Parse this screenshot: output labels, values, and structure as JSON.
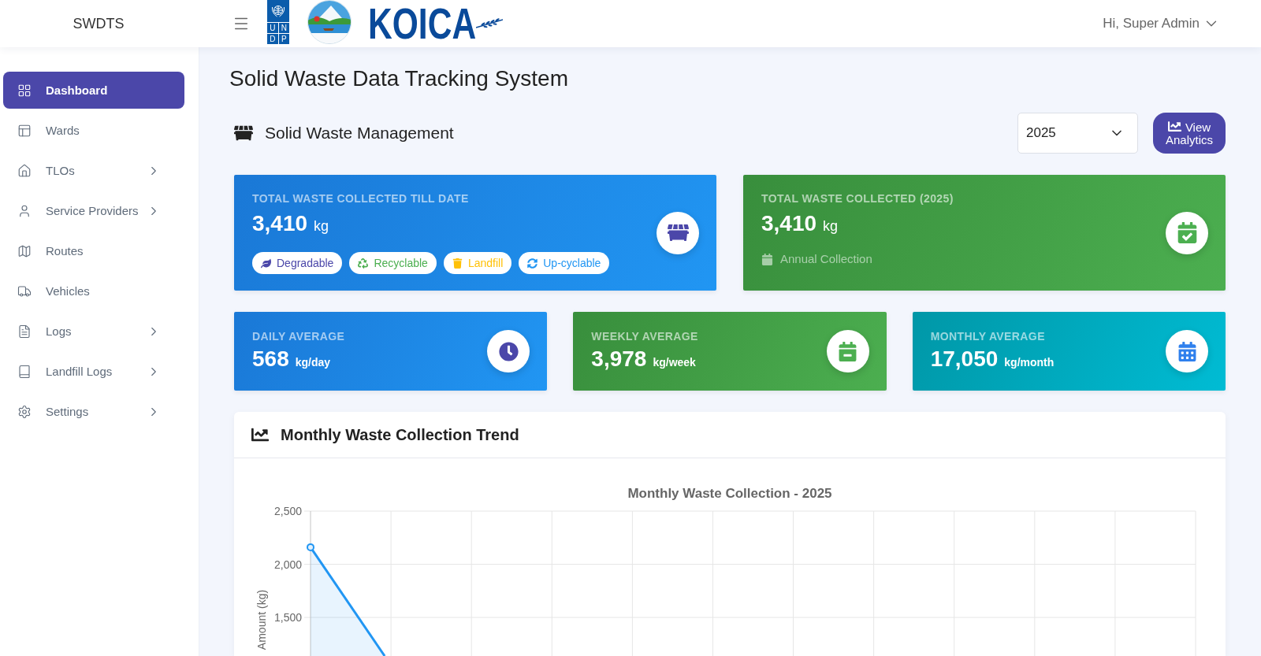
{
  "header": {
    "brand": "SWDTS",
    "undp_logo_letters": [
      "U",
      "N",
      "D",
      "P"
    ],
    "partner_logo_text": "KOICA",
    "user_greeting": "Hi, Super Admin"
  },
  "sidebar": {
    "items": [
      {
        "label": "Dashboard",
        "selected": true,
        "expandable": false
      },
      {
        "label": "Wards",
        "selected": false,
        "expandable": false
      },
      {
        "label": "TLOs",
        "selected": false,
        "expandable": true
      },
      {
        "label": "Service Providers",
        "selected": false,
        "expandable": true
      },
      {
        "label": "Routes",
        "selected": false,
        "expandable": false
      },
      {
        "label": "Vehicles",
        "selected": false,
        "expandable": false
      },
      {
        "label": "Logs",
        "selected": false,
        "expandable": true
      },
      {
        "label": "Landfill Logs",
        "selected": false,
        "expandable": true
      },
      {
        "label": "Settings",
        "selected": false,
        "expandable": true
      }
    ]
  },
  "page": {
    "title": "Solid Waste Data Tracking System"
  },
  "section": {
    "title": "Solid Waste Management",
    "year_select": "2025",
    "analytics_button": "View Analytics"
  },
  "summary_cards": [
    {
      "label": "TOTAL WASTE COLLECTED TILL DATE",
      "value": "3,410",
      "unit": "kg",
      "tags": [
        {
          "label": "Degradable",
          "color": "#4b47a9"
        },
        {
          "label": "Recyclable",
          "color": "#4caf50"
        },
        {
          "label": "Landfill",
          "color": "#ffc107"
        },
        {
          "label": "Up-cyclable",
          "color": "#2196f3"
        }
      ]
    },
    {
      "label": "TOTAL WASTE COLLECTED (2025)",
      "value": "3,410",
      "unit": "kg",
      "note": "Annual Collection"
    }
  ],
  "average_cards": [
    {
      "label": "DAILY AVERAGE",
      "value": "568",
      "unit": "kg/day"
    },
    {
      "label": "WEEKLY AVERAGE",
      "value": "3,978",
      "unit": "kg/week"
    },
    {
      "label": "MONTHLY AVERAGE",
      "value": "17,050",
      "unit": "kg/month"
    }
  ],
  "trend_panel": {
    "title": "Monthly Waste Collection Trend",
    "chart": {
      "title": "Monthly Waste Collection - 2025",
      "y_axis_title": "Amount (kg)",
      "y_tick_labels": [
        "2,500",
        "2,000",
        "1,500"
      ]
    }
  }
}
